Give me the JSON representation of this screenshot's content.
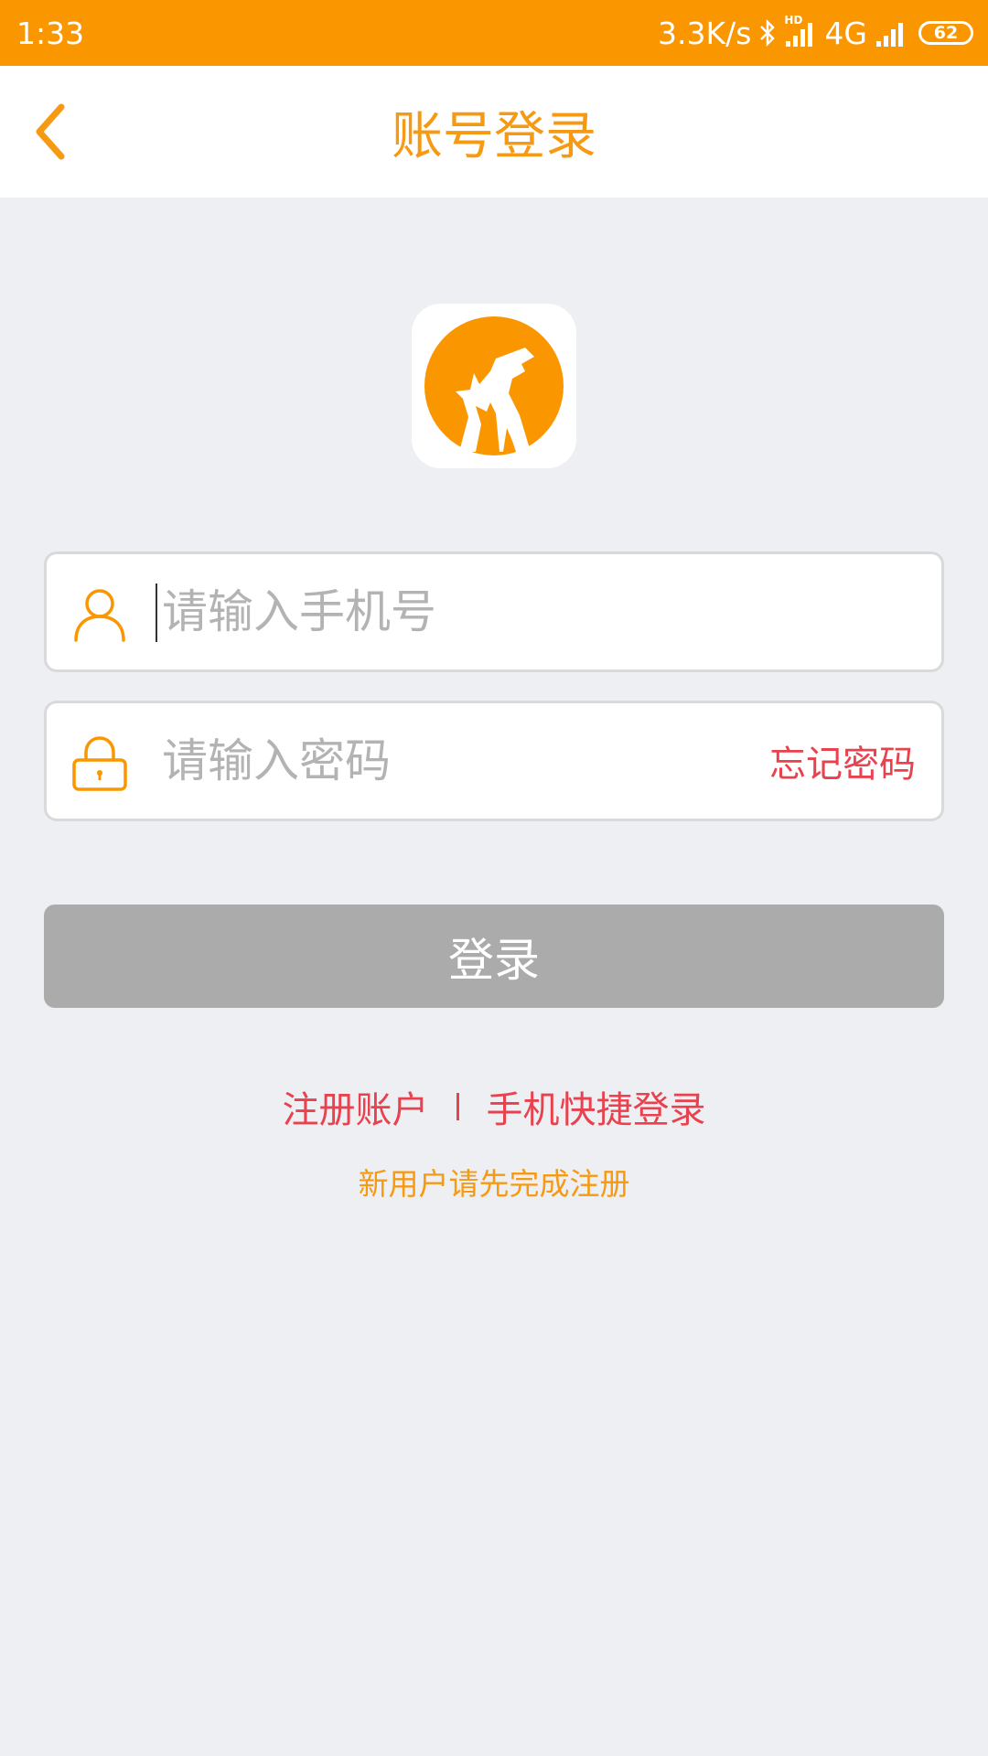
{
  "status_bar": {
    "time": "1:33",
    "net_speed": "3.3K/s",
    "network": "4G",
    "hd_label": "HD",
    "battery": "62"
  },
  "nav": {
    "title": "账号登录",
    "back_icon": "chevron-left-icon"
  },
  "logo": {
    "icon": "wolf-logo-icon"
  },
  "form": {
    "phone_placeholder": "请输入手机号",
    "password_placeholder": "请输入密码",
    "forgot_label": "忘记密码",
    "user_icon": "user-icon",
    "lock_icon": "lock-icon"
  },
  "login_label": "登录",
  "links": {
    "register": "注册账户",
    "quick_login": "手机快捷登录",
    "hint": "新用户请先完成注册"
  },
  "colors": {
    "accent": "#f99600",
    "title": "#f59a12",
    "link_red": "#e8424f",
    "button_disabled": "#ababab",
    "background": "#eeeff3"
  }
}
